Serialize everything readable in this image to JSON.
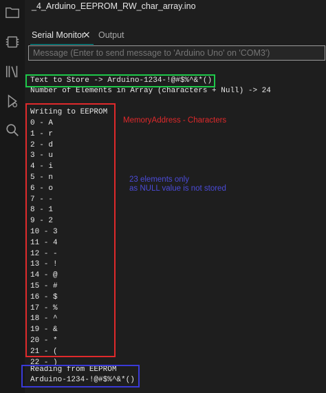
{
  "app": {
    "file_tab": "_4_Arduino_EEPROM_RW_char_array.ino"
  },
  "activity_bar": {
    "icons": [
      "folder-icon",
      "board-icon",
      "library-icon",
      "debug-icon",
      "search-icon"
    ]
  },
  "panel": {
    "tabs": [
      {
        "label": "Serial Monitor",
        "active": true
      },
      {
        "label": "Output",
        "active": false
      }
    ],
    "close_symbol": "×",
    "message_placeholder": "Message (Enter to send message to 'Arduino Uno' on 'COM3')"
  },
  "serial_output": {
    "text_to_store": "Text to Store -> Arduino-1234-!@#$%^&*()",
    "num_elements": "Number of Elements in Array (characters + Null) -> 24",
    "writing_header": "Writing to EEPROM",
    "entries": [
      "0 - A",
      "1 - r",
      "2 - d",
      "3 - u",
      "4 - i",
      "5 - n",
      "6 - o",
      "7 - -",
      "8 - 1",
      "9 - 2",
      "10 - 3",
      "11 - 4",
      "12 - -",
      "13 - !",
      "14 - @",
      "15 - #",
      "16 - $",
      "17 - %",
      "18 - ^",
      "19 - &",
      "20 - *",
      "21 - (",
      "22 - )"
    ],
    "reading_header": "Reading from EEPROM",
    "read_result": "Arduino-1234-!@#$%^&*()"
  },
  "annotations": {
    "red_label": "MemoryAddress - Characters",
    "blue_line1": "23 elements only",
    "blue_line2": "as NULL value is not stored"
  },
  "colors": {
    "green_box": "#1ec94a",
    "red_box": "#e0292b",
    "blue_box": "#3a3ad8",
    "accent_teal": "#00a0a0"
  }
}
